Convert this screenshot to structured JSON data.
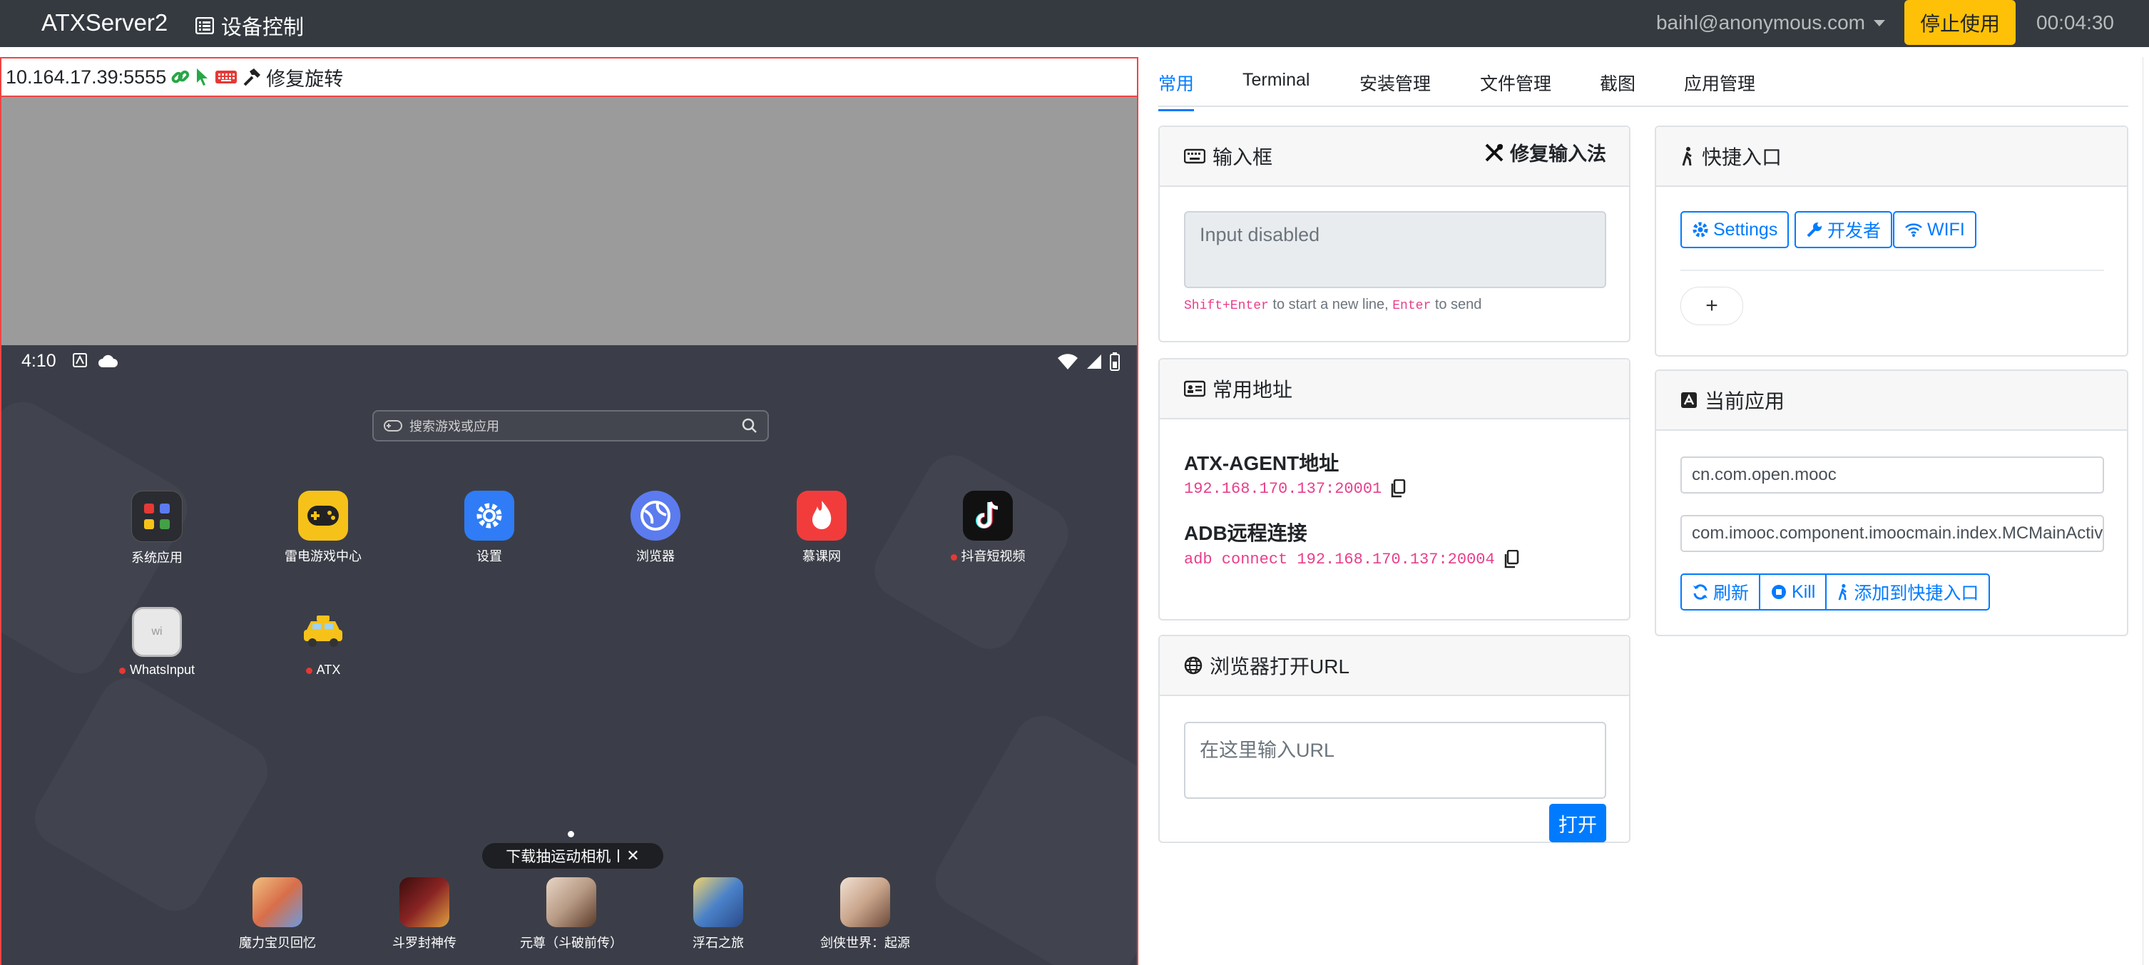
{
  "navbar": {
    "brand": "ATXServer2",
    "device_control": "设备控制",
    "user": "baihl@anonymous.com",
    "stop_button": "停止使用",
    "timer": "00:04:30"
  },
  "device": {
    "address": "10.164.17.39:5555",
    "fix_rotation": "修复旋转",
    "status_time": "4:10",
    "search_placeholder": "搜索游戏或应用",
    "apps": [
      {
        "label": "系统应用",
        "icon": "system-apps-icon",
        "color": "#2a2c31"
      },
      {
        "label": "雷电游戏中心",
        "icon": "gamepad-icon",
        "color": "#f6c21a"
      },
      {
        "label": "设置",
        "icon": "settings-icon",
        "color": "#2f7cf6"
      },
      {
        "label": "浏览器",
        "icon": "browser-icon",
        "color": "#5b7bef"
      },
      {
        "label": "慕课网",
        "icon": "mooc-icon",
        "color": "#f23c3c"
      },
      {
        "label": "抖音短视频",
        "icon": "tiktok-icon",
        "color": "#111111"
      },
      {
        "label": "WhatsInput",
        "icon": "whatsinput-icon",
        "color": "#e8e8e8"
      },
      {
        "label": "ATX",
        "icon": "atx-taxi-icon",
        "color": "#f6c21a"
      }
    ],
    "toast": "下载抽运动相机",
    "dock": [
      {
        "label": "魔力宝贝回忆",
        "color": "#d86e4a"
      },
      {
        "label": "斗罗封神传",
        "color": "#8a2424"
      },
      {
        "label": "元尊（斗破前传）",
        "color": "#b79a84"
      },
      {
        "label": "浮石之旅",
        "color": "#4a82c9"
      },
      {
        "label": "剑侠世界：起源",
        "color": "#c9a48b"
      }
    ]
  },
  "tabs": [
    "常用",
    "Terminal",
    "安装管理",
    "文件管理",
    "截图",
    "应用管理"
  ],
  "input_card": {
    "title": "输入框",
    "fix_label": "修复输入法",
    "placeholder": "Input disabled",
    "hint_key1": "Shift+Enter",
    "hint_text1": " to start a new line, ",
    "hint_key2": "Enter",
    "hint_text2": " to send"
  },
  "address_card": {
    "title": "常用地址",
    "agent_label": "ATX-AGENT地址",
    "agent_value": "192.168.170.137:20001",
    "adb_label": "ADB远程连接",
    "adb_value": "adb connect 192.168.170.137:20004"
  },
  "url_card": {
    "title": "浏览器打开URL",
    "placeholder": "在这里输入URL",
    "open_button": "打开"
  },
  "shortcut_card": {
    "title": "快捷入口",
    "settings": "Settings",
    "developer": "开发者",
    "wifi": "WIFI",
    "add": "+"
  },
  "current_app_card": {
    "title": "当前应用",
    "package": "cn.com.open.mooc",
    "activity": "com.imooc.component.imoocmain.index.MCMainActivity",
    "refresh": "刷新",
    "kill": "Kill",
    "add_shortcut": "添加到快捷入口"
  },
  "colors": {
    "primary": "#007bff",
    "warning": "#ffc107",
    "navbar": "#343a40",
    "border_red": "#ef4444"
  }
}
